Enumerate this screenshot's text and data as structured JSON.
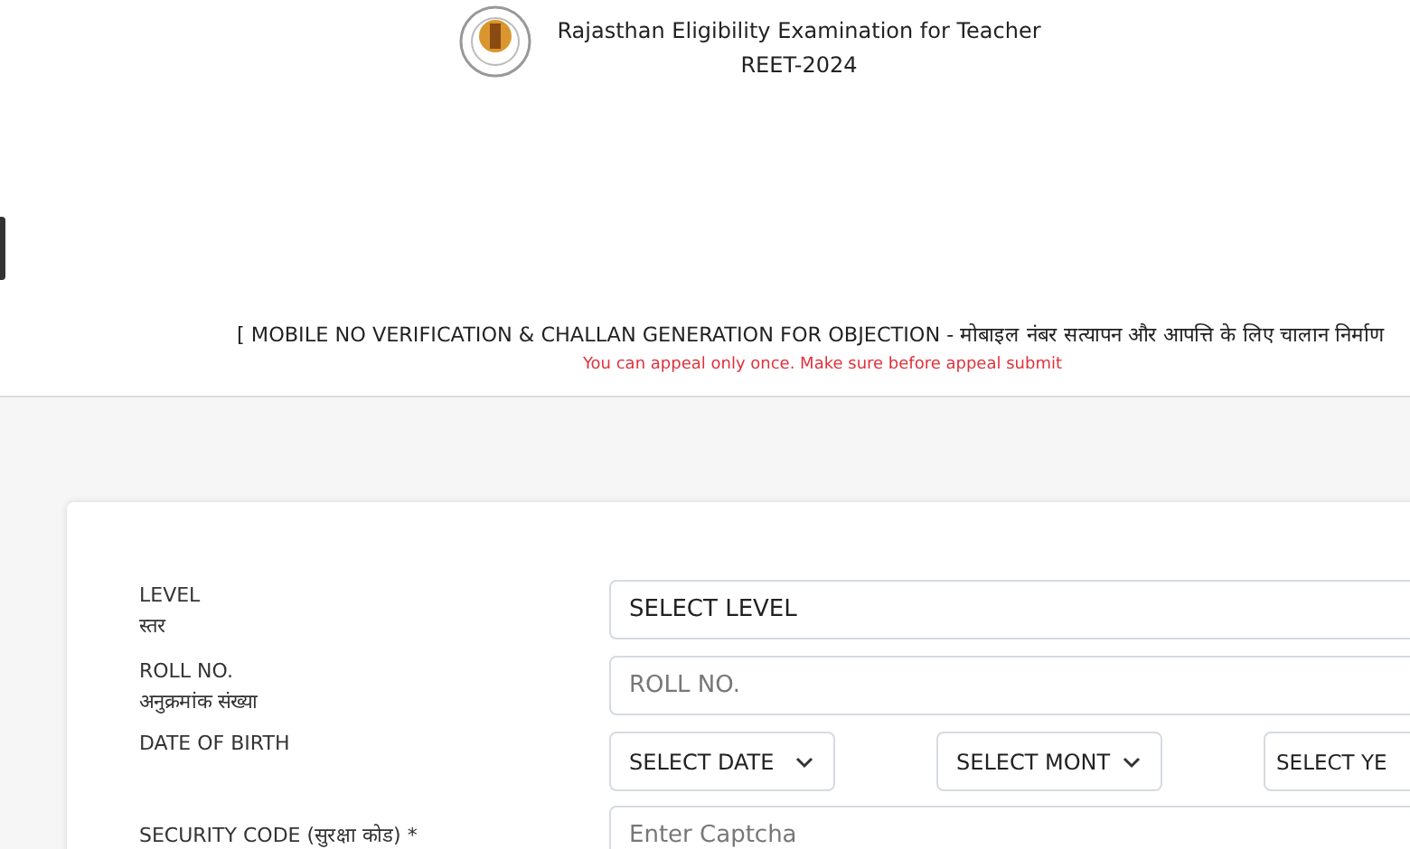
{
  "header": {
    "title": "Rajasthan Eligibility Examination for Teacher",
    "subtitle": "REET-2024"
  },
  "heading": "[ MOBILE NO VERIFICATION & CHALLAN GENERATION FOR OBJECTION - मोबाइल नंबर सत्यापन और आपत्ति के लिए चालान निर्माण",
  "notice": "You can appeal only once. Make sure before appeal submit",
  "form": {
    "rows": [
      {
        "kind": "select",
        "label": "LEVEL",
        "label_hi": "स्तर",
        "value": "SELECT LEVEL"
      },
      {
        "kind": "input",
        "label": "ROLL NO.",
        "label_hi": "अनुक्रमांक संख्या",
        "placeholder": "ROLL NO."
      },
      {
        "kind": "date",
        "label": "DATE OF BIRTH",
        "selects": [
          "SELECT DATE",
          "SELECT MONT",
          "SELECT YE"
        ]
      },
      {
        "kind": "input",
        "label": "SECURITY CODE (सुरक्षा कोड) *",
        "placeholder": "Enter Captcha"
      }
    ]
  }
}
